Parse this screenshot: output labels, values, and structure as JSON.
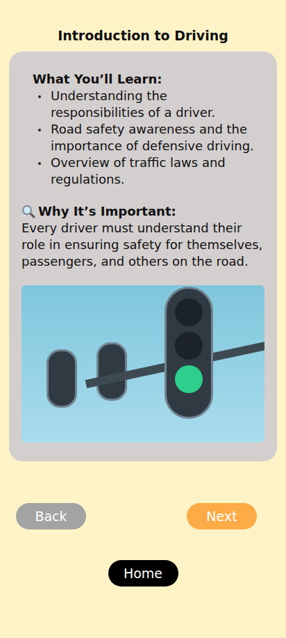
{
  "title": "Introduction to Driving",
  "learn": {
    "heading": "What You’ll Learn:",
    "items": [
      "Understanding the responsibilities of a driver.",
      "Road safety awareness and the importance of defensive driving.",
      "Overview of traffic laws and regulations."
    ]
  },
  "importance": {
    "heading": "Why It’s Important:",
    "text": "Every driver must understand their role in ensuring safety for themselves, passengers, and others on the road."
  },
  "nav": [
    {
      "label": "Back",
      "kind": "back"
    },
    {
      "label": "Next",
      "kind": "next"
    }
  ],
  "home": "Home"
}
